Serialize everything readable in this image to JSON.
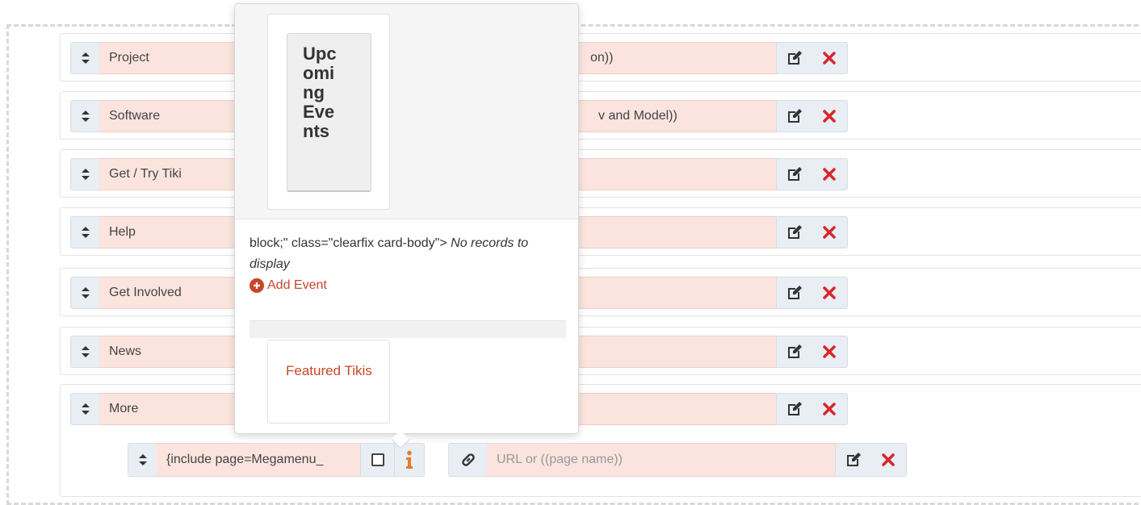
{
  "menu_items": [
    {
      "label": "Project",
      "url_fragment": "on))"
    },
    {
      "label": "Software",
      "url_fragment": "v and Model))"
    },
    {
      "label": "Get / Try Tiki",
      "url_fragment": ""
    },
    {
      "label": "Help",
      "url_fragment": ""
    },
    {
      "label": "Get Involved",
      "url_fragment": ""
    },
    {
      "label": "News",
      "url_fragment": ""
    },
    {
      "label": "More",
      "url_fragment": ""
    }
  ],
  "child_item": {
    "label": "{include page=Megamenu_",
    "url_placeholder": "URL or ((page name))"
  },
  "popover": {
    "upcoming_events": "Upc\nomi\nng\nEve\nnts",
    "code_text": "block;\" class=\"clearfix card-body\">",
    "no_records": "No records to display",
    "add_event": "Add Event",
    "featured_tikis": "Featured Tikis"
  },
  "icons": {
    "handle": "sort-icon",
    "edit": "edit-icon",
    "remove": "close-icon",
    "info": "info-icon",
    "link": "link-icon",
    "checkbox": "checkbox-icon",
    "add": "plus-circle-icon"
  },
  "colors": {
    "field_bg": "#fbe4de",
    "button_bg": "#e8eef3",
    "danger": "#d9262a",
    "accent": "#c7472a",
    "info": "#e8792b"
  }
}
